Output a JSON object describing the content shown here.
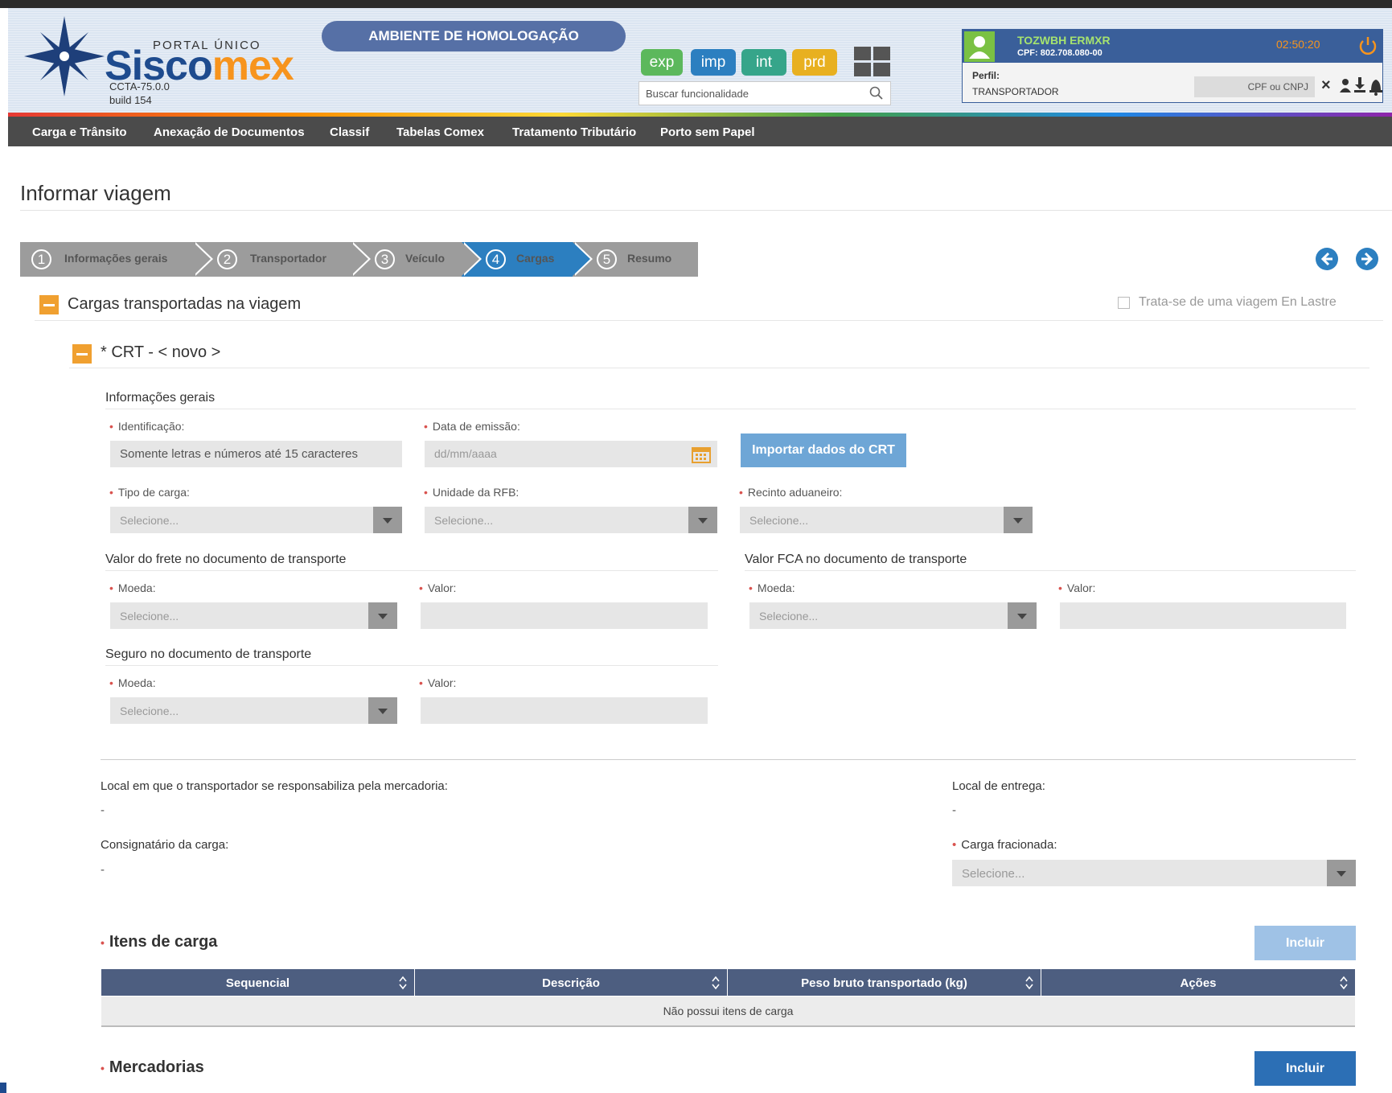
{
  "header": {
    "portal": "PORTAL ÚNICO",
    "brand_main": "Sisco",
    "brand_accent": "mex",
    "version": "CCTA-75.0.0",
    "build": "build 154",
    "ambiente": "AMBIENTE DE HOMOLOGAÇÃO",
    "env_buttons": [
      "exp",
      "imp",
      "int",
      "prd"
    ],
    "search_placeholder": "Buscar funcionalidade",
    "user_name": "TOZWBH ERMXR",
    "user_cpf": "CPF: 802.708.080-00",
    "clock": "02:50:20",
    "perfil_label": "Perfil:",
    "perfil_value": "TRANSPORTADOR",
    "cpf_cnpj_placeholder": "CPF ou CNPJ",
    "close_x": "×"
  },
  "nav": [
    "Carga e Trânsito",
    "Anexação de Documentos",
    "Classif",
    "Tabelas Comex",
    "Tratamento Tributário",
    "Porto sem Papel"
  ],
  "page_title": "Informar viagem",
  "steps": [
    {
      "num": "1",
      "label": "Informações gerais"
    },
    {
      "num": "2",
      "label": "Transportador"
    },
    {
      "num": "3",
      "label": "Veículo"
    },
    {
      "num": "4",
      "label": "Cargas"
    },
    {
      "num": "5",
      "label": "Resumo"
    }
  ],
  "section": {
    "title": "Cargas transportadas na viagem",
    "checkbox_label": "Trata-se de uma viagem En Lastre",
    "crt_title": "* CRT - < novo >"
  },
  "form": {
    "info_gerais": "Informações gerais",
    "identificacao_label": "Identificação:",
    "identificacao_placeholder": "Somente letras e números até 15 caracteres",
    "data_label": "Data de emissão:",
    "data_placeholder": "dd/mm/aaaa",
    "importar": "Importar dados do CRT",
    "tipo_label": "Tipo de carga:",
    "unidade_label": "Unidade da RFB:",
    "recinto_label": "Recinto aduaneiro:",
    "select_placeholder": "Selecione...",
    "frete_title": "Valor do frete no documento de transporte",
    "fca_title": "Valor FCA no documento de transporte",
    "seguro_title": "Seguro no documento de transporte",
    "moeda_label": "Moeda:",
    "valor_label": "Valor:",
    "local_resp_label": "Local em que o transportador se responsabiliza pela mercadoria:",
    "local_resp_value": "-",
    "local_entrega_label": "Local de entrega:",
    "local_entrega_value": "-",
    "consignatario_label": "Consignatário da carga:",
    "consignatario_value": "-",
    "fracionada_label": "Carga fracionada:"
  },
  "itens": {
    "title": "Itens de carga",
    "incluir": "Incluir",
    "columns": [
      "Sequencial",
      "Descrição",
      "Peso bruto transportado (kg)",
      "Ações"
    ],
    "empty": "Não possui itens de carga"
  },
  "mercadorias": {
    "title": "Mercadorias",
    "incluir": "Incluir"
  },
  "colors": {
    "brand_blue": "#1e4b8e",
    "brand_orange": "#f7941d",
    "step_active": "#2c7fc0",
    "table_header": "#4d5e80",
    "exp": "#5cb85c",
    "imp": "#2c7fc0",
    "int": "#36a58a",
    "prd": "#e8b020"
  }
}
